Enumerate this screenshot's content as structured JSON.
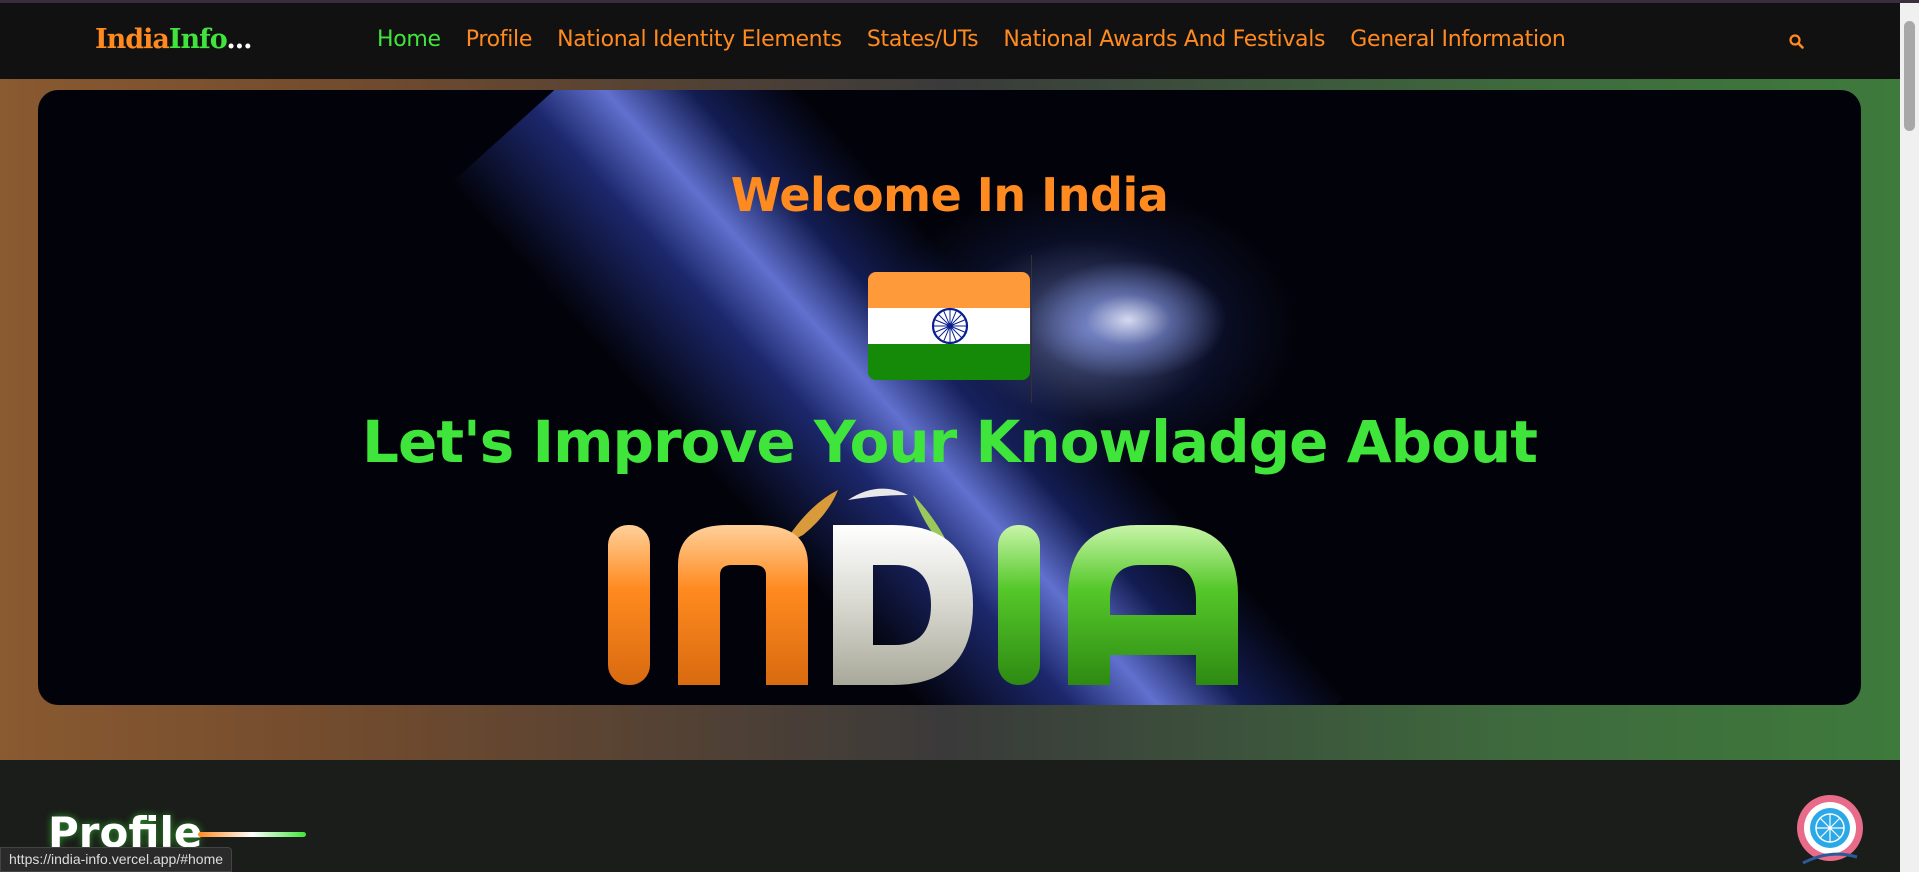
{
  "navbar": {
    "logo": {
      "part1": "India",
      "part2": "Info",
      "part3": "..."
    },
    "links": [
      {
        "label": "Home",
        "active": true
      },
      {
        "label": "Profile",
        "active": false
      },
      {
        "label": "National Identity Elements",
        "active": false
      },
      {
        "label": "States/UTs",
        "active": false
      },
      {
        "label": "National Awards And Festivals",
        "active": false
      },
      {
        "label": "General Information",
        "active": false
      }
    ],
    "search_icon": "search-icon"
  },
  "hero": {
    "welcome": "Welcome In India",
    "tagline": "Let's Improve Your Knowladge About",
    "art_text": "INDIA",
    "flag_icon": "indian-flag-icon"
  },
  "profile": {
    "title": "Profile"
  },
  "status_bar": {
    "url": "https://india-info.vercel.app/#home"
  },
  "colors": {
    "saffron": "#ff8a1f",
    "green": "#3fe53a",
    "navbar_bg": "#111111"
  }
}
